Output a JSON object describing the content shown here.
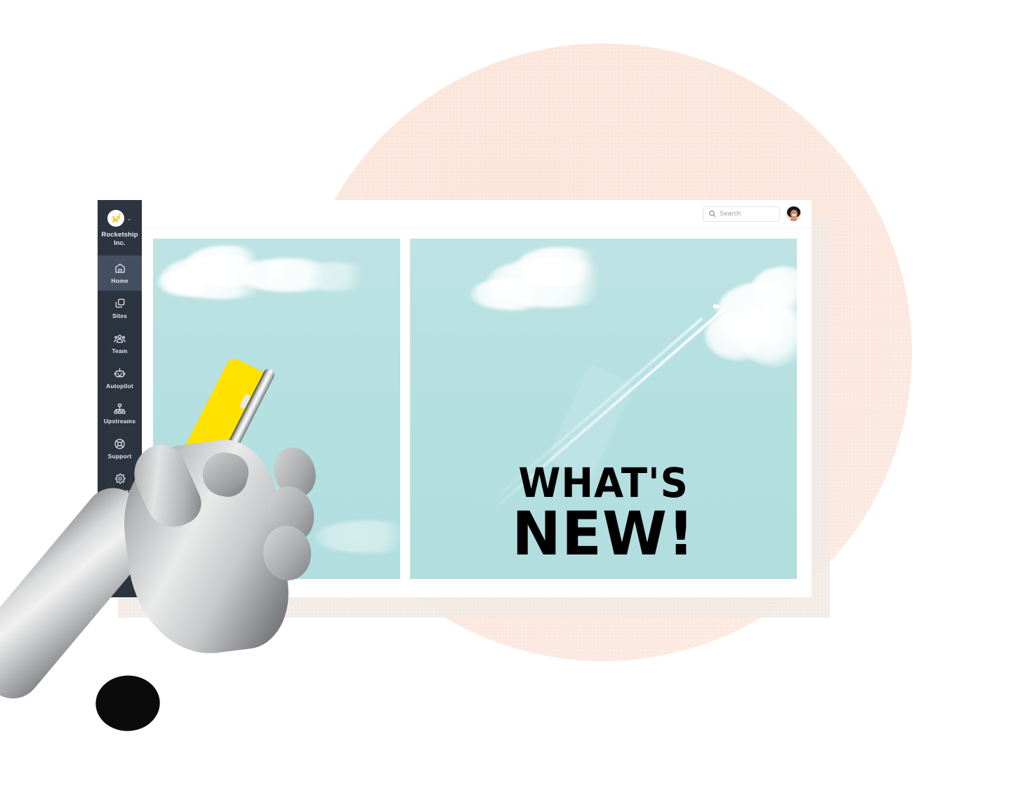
{
  "app": {
    "brand_name": "Rocketship Inc.",
    "brand_icon": "rocket-logo-icon",
    "brand_chevron": "⌄"
  },
  "sidebar": {
    "items": [
      {
        "label": "Home",
        "icon": "home-icon",
        "active": true
      },
      {
        "label": "Sites",
        "icon": "sites-icon",
        "active": false
      },
      {
        "label": "Team",
        "icon": "team-icon",
        "active": false
      },
      {
        "label": "Autopilot",
        "icon": "robot-icon",
        "active": false
      },
      {
        "label": "Upstreams",
        "icon": "sitemap-icon",
        "active": false
      },
      {
        "label": "Support",
        "icon": "lifebuoy-icon",
        "active": false
      },
      {
        "label": "Settings",
        "icon": "gear-icon",
        "active": false
      }
    ]
  },
  "header": {
    "search": {
      "placeholder": "Search",
      "value": "",
      "icon": "search-icon"
    },
    "avatar_alt": "user-avatar"
  },
  "main": {
    "panels": [
      {
        "name": "sky-photo-left",
        "alt": "Sky with clouds and a hand holding a yellow phone"
      },
      {
        "name": "sky-photo-right",
        "alt": "Sky with clouds and a jet contrail"
      }
    ],
    "headline": {
      "line1": "WHAT'S",
      "line2": "NEW!"
    }
  },
  "colors": {
    "sidebar_bg": "#2c3440",
    "sidebar_active": "#445062",
    "sky": "#b6e0e1",
    "phone_yellow": "#ffe200",
    "backdrop_peach": "#fbe8de",
    "card_shadow": "#f4ece7",
    "headline_text": "#000000"
  }
}
